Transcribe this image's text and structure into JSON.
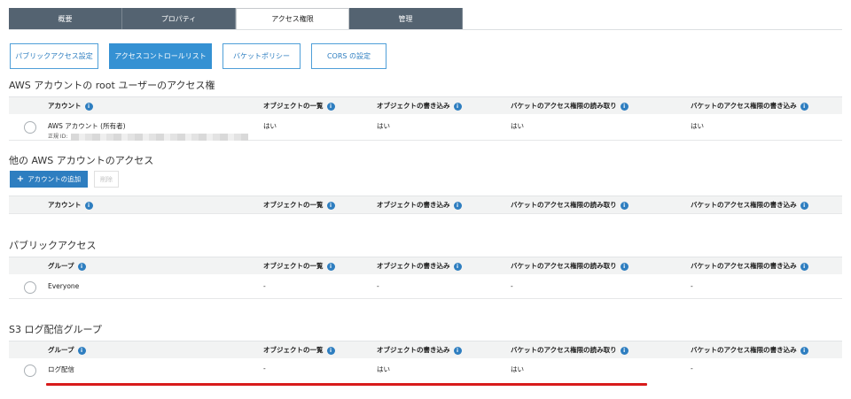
{
  "tabs": [
    {
      "label": "概要",
      "active": false
    },
    {
      "label": "プロパティ",
      "active": false
    },
    {
      "label": "アクセス権限",
      "active": true
    },
    {
      "label": "管理",
      "active": false
    }
  ],
  "subtabs": [
    {
      "label": "パブリックアクセス設定",
      "active": false
    },
    {
      "label": "アクセスコントロールリスト",
      "active": true
    },
    {
      "label": "バケットポリシー",
      "active": false
    },
    {
      "label": "CORS の設定",
      "active": false
    }
  ],
  "columns": {
    "list_objects": "オブジェクトの一覧",
    "write_objects": "オブジェクトの書き込み",
    "read_bucket_acl": "バケットのアクセス権限の読み取り",
    "write_bucket_acl": "バケットのアクセス権限の書き込み"
  },
  "root_section": {
    "title": "AWS アカウントの root ユーザーのアクセス権",
    "first_col": "アカウント",
    "row": {
      "name": "AWS アカウント (所有者)",
      "canonical_label": "正規 ID:",
      "list": "はい",
      "write": "はい",
      "read_acl": "はい",
      "write_acl": "はい"
    }
  },
  "other_section": {
    "title": "他の AWS アカウントのアクセス",
    "add_button": "アカウントの追加",
    "delete_button": "削除",
    "first_col": "アカウント"
  },
  "public_section": {
    "title": "パブリックアクセス",
    "first_col": "グループ",
    "row": {
      "name": "Everyone",
      "list": "-",
      "write": "-",
      "read_acl": "-",
      "write_acl": "-"
    }
  },
  "s3log_section": {
    "title": "S3 ログ配信グループ",
    "first_col": "グループ",
    "row": {
      "name": "ログ配信",
      "list": "-",
      "write": "はい",
      "read_acl": "はい",
      "write_acl": "-"
    }
  },
  "colors": {
    "accent": "#3591d3",
    "tab_dark": "#546371",
    "highlight": "#d81b1b"
  }
}
